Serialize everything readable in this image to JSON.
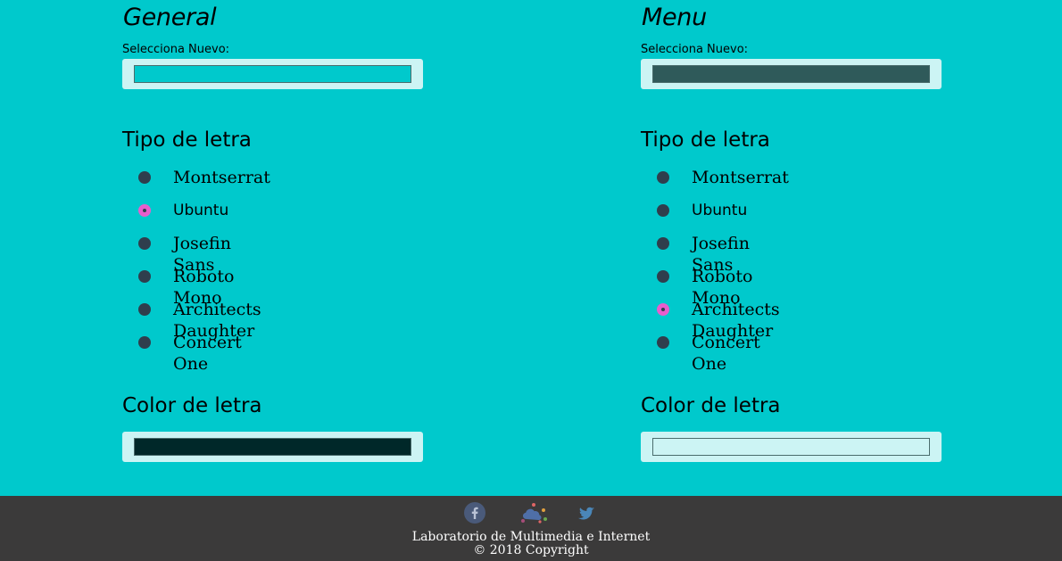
{
  "colors": {
    "background": "#00c9cc",
    "panel": "#ccf4f4",
    "footer": "#3b3a3a",
    "radio_checked": "#e85dcc",
    "radio_unchecked": "#2f3e4d"
  },
  "general": {
    "title": "General",
    "picker_label": "Selecciona Nuevo:",
    "background_value": "#00c9cc",
    "font_heading": "Tipo de letra",
    "fonts": [
      {
        "label": "Montserrat",
        "checked": false
      },
      {
        "label": "Ubuntu",
        "checked": true
      },
      {
        "label": "Josefin Sans",
        "checked": false
      },
      {
        "label": "Roboto Mono",
        "checked": false
      },
      {
        "label": "Architects Daughter",
        "checked": false
      },
      {
        "label": "Concert One",
        "checked": false
      }
    ],
    "color_heading": "Color de letra",
    "text_color_value": "#002829"
  },
  "menu": {
    "title": "Menu",
    "picker_label": "Selecciona Nuevo:",
    "background_value": "#2f5a5a",
    "font_heading": "Tipo de letra",
    "fonts": [
      {
        "label": "Montserrat",
        "checked": false
      },
      {
        "label": "Ubuntu",
        "checked": false
      },
      {
        "label": "Josefin Sans",
        "checked": false
      },
      {
        "label": "Roboto Mono",
        "checked": false
      },
      {
        "label": "Architects Daughter",
        "checked": true
      },
      {
        "label": "Concert One",
        "checked": false
      }
    ],
    "color_heading": "Color de letra",
    "text_color_value": "#ccf4f4"
  },
  "footer": {
    "social_icons": [
      "facebook-icon",
      "cloud-network-icon",
      "twitter-icon"
    ],
    "line1": "Laboratorio de Multimedia e Internet",
    "line2": "© 2018 Copyright"
  }
}
